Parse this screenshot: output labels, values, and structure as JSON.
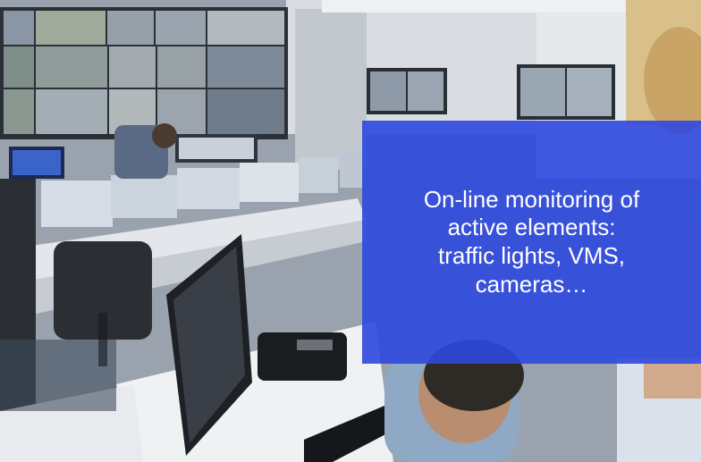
{
  "caption": {
    "lines": [
      "On-line monitoring of",
      "active elements:",
      "traffic lights, VMS,",
      "cameras…"
    ]
  },
  "colors": {
    "overlay": "#2e48de",
    "caption_text": "#ffffff"
  }
}
